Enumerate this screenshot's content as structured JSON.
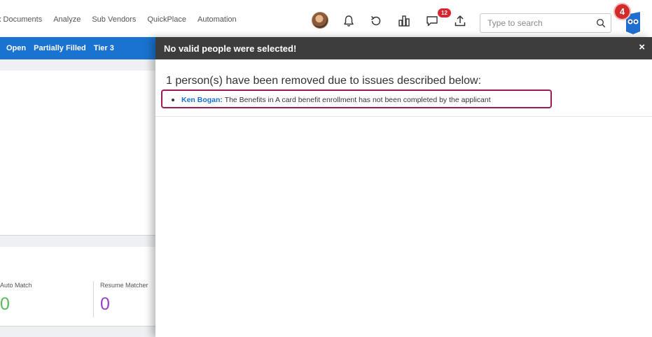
{
  "nav": {
    "links": [
      "x Documents",
      "Analyze",
      "Sub Vendors",
      "QuickPlace",
      "Automation"
    ],
    "message_badge": "12",
    "notification_badge": "4",
    "search_placeholder": "Type to search"
  },
  "filters": {
    "tabs": [
      "Open",
      "Partially Filled",
      "Tier 3"
    ]
  },
  "stats": {
    "auto_match_label": "Auto Match",
    "auto_match_value": "0",
    "auto_match_color": "#5cb85c",
    "resume_matcher_label": "Resume Matcher",
    "resume_matcher_value": "0",
    "resume_matcher_color": "#9b3fc9"
  },
  "modal": {
    "title": "No valid people were selected!",
    "close_label": "×",
    "message": "1 person(s) have been removed due to issues described below:",
    "issues": [
      {
        "name": "Ken Bogan:",
        "text": " The Benefits in A card benefit enrollment has not been completed by the applicant"
      }
    ]
  },
  "colors": {
    "filter_bar": "#1a73d1",
    "modal_header": "#3d3d3d",
    "highlight_border": "#9b1c54",
    "badge": "#d8252e"
  }
}
